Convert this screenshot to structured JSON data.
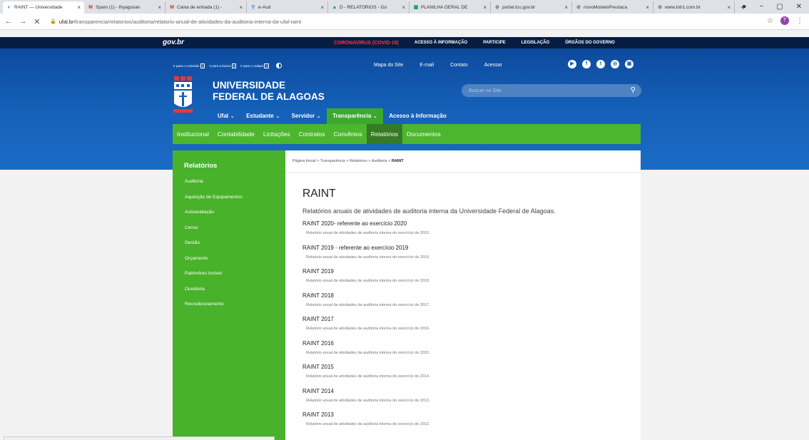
{
  "browser": {
    "tabs": [
      {
        "title": "RAINT — Universidade",
        "icon": "ufal-icon",
        "color": "#1a73e8",
        "glyph": "◐"
      },
      {
        "title": "Spam (1) - thyagosan",
        "icon": "gmail-icon",
        "color": "#d93025",
        "glyph": "M"
      },
      {
        "title": "Caixa de entrada (1) -",
        "icon": "gmail-icon",
        "color": "#d93025",
        "glyph": "M"
      },
      {
        "title": "e-Aud",
        "icon": "search-icon",
        "color": "#4285f4",
        "glyph": "⚲"
      },
      {
        "title": "D - RELATORIOS - Go",
        "icon": "drive-icon",
        "color": "#0f9d58",
        "glyph": "▲"
      },
      {
        "title": "PLANILHA GERAL DE",
        "icon": "sheets-icon",
        "color": "#0f9d58",
        "glyph": "▦"
      },
      {
        "title": "portal.tcu.gov.br",
        "icon": "globe-icon",
        "color": "#5f6368",
        "glyph": "⊘"
      },
      {
        "title": "novoModeloPrestaca",
        "icon": "globe-icon",
        "color": "#5f6368",
        "glyph": "⊘"
      },
      {
        "title": "www.tnh1.com.br",
        "icon": "globe-icon",
        "color": "#5f6368",
        "glyph": "⊘"
      }
    ],
    "url_host": "ufal.br",
    "url_path": "/transparencia/relatorios/auditoria/relatorio-anual-de-atividades-da-auditoria-interna-da-ufal-raint",
    "profile_initial": "T"
  },
  "gov": {
    "logo": "gov.br",
    "links": [
      "CORONAVÍRUS (COVID-19)",
      "ACESSO À INFORMAÇÃO",
      "PARTICIPE",
      "LEGISLAÇÃO",
      "ÓRGÃOS DO GOVERNO"
    ]
  },
  "accessibility": {
    "content": "Ir para o conteúdo",
    "content_key": "1",
    "search": "Ir para a busca",
    "search_key": "2",
    "footer": "Ir para o rodapé",
    "footer_key": "3"
  },
  "top_links": [
    "Mapa do Site",
    "E-mail",
    "Contato",
    "Acessar"
  ],
  "university": {
    "line1": "UNIVERSIDADE",
    "line2": "FEDERAL DE ALAGOAS"
  },
  "search": {
    "placeholder": "Buscar no Site"
  },
  "main_nav": [
    "Ufal",
    "Estudante",
    "Servidor",
    "Transparência",
    "Acesso à Informação"
  ],
  "sub_nav": [
    "Institucional",
    "Contabilidade",
    "Licitações",
    "Contratos",
    "Convênios",
    "Relatórios",
    "Documentos"
  ],
  "sidebar": {
    "title": "Relatórios",
    "items": [
      "Auditoria",
      "Aquisição de Equipamentos",
      "Autoavaliação",
      "Censo",
      "Gestão",
      "Orçamento",
      "Patrimônio Imóvel",
      "Ouvidoria",
      "Recredenciamento"
    ]
  },
  "breadcrumb": {
    "path": "Página Inicial > Transparência > Relatórios > Auditoria > ",
    "current": "RAINT"
  },
  "page": {
    "title": "RAINT",
    "subtitle": "Relatórios anuais de atividades de auditoria interna da Universidade Federal de Alagoas.",
    "entries": [
      {
        "title": "RAINT 2020- referente ao exercício 2020",
        "desc": "Relatório anual de atividades de auditoria interna do exercício de 2020."
      },
      {
        "title": "RAINT 2019 - referente ao exercício 2019",
        "desc": "Relatório anual de atividades de auditoria interna do exercício de 2019."
      },
      {
        "title": "RAINT 2019",
        "desc": "Relatório anual de atividades de auditoria interna do exercício de 2018."
      },
      {
        "title": "RAINT 2018",
        "desc": "Relatório anual de atividades da auditoria interna do exercício de 2017."
      },
      {
        "title": "RAINT 2017",
        "desc": "Relatório anual de atividades da auditoria interna do exercício de 2016."
      },
      {
        "title": "RAINT 2016",
        "desc": "Relatório anual de atividades da auditoria interna do exercício de 2015."
      },
      {
        "title": "RAINT 2015",
        "desc": "Relatório anual de atividades de auditoria interna do exercício de 2014."
      },
      {
        "title": "RAINT 2014",
        "desc": "Relatório anual de atividades de auditoria interna do exercício de 2013."
      },
      {
        "title": "RAINT 2013",
        "desc": "Relatório anual de atividades da auditoria interna do exercício de 2012."
      }
    ]
  }
}
